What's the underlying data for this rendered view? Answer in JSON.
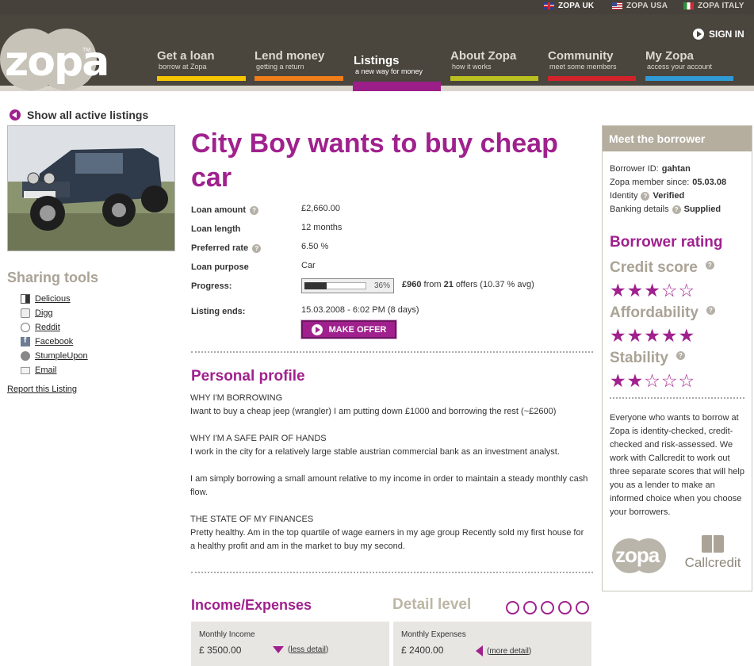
{
  "countries": [
    {
      "label": "ZOPA UK",
      "flag": "uk-flag-icon",
      "active": true
    },
    {
      "label": "ZOPA USA",
      "flag": "us-flag-icon",
      "active": false
    },
    {
      "label": "ZOPA ITALY",
      "flag": "italy-flag-icon",
      "active": false
    }
  ],
  "logo": {
    "text": "zopa",
    "tm": "TM"
  },
  "signin": "SIGN IN",
  "nav": [
    {
      "title": "Get a loan",
      "sub": "borrow at Zopa",
      "color": "#f5c500"
    },
    {
      "title": "Lend money",
      "sub": "getting a return",
      "color": "#ef7d1a"
    },
    {
      "title": "Listings",
      "sub": "a new way for money",
      "color": "#9c1e88"
    },
    {
      "title": "About Zopa",
      "sub": "how it works",
      "color": "#b9c01f"
    },
    {
      "title": "Community",
      "sub": "meet some members",
      "color": "#d2232a"
    },
    {
      "title": "My Zopa",
      "sub": "access your account",
      "color": "#2f9ad6"
    }
  ],
  "back_link": "Show all active listings",
  "sharing": {
    "title": "Sharing tools",
    "items": [
      "Delicious",
      "Digg",
      "Reddit",
      "Facebook",
      "StumpleUpon",
      "Email"
    ],
    "report": "Report this Listing"
  },
  "listing": {
    "title": "City Boy wants to buy cheap car",
    "loan_amount_label": "Loan amount",
    "loan_amount": "£2,660.00",
    "loan_length_label": "Loan length",
    "loan_length": "12 months",
    "preferred_rate_label": "Preferred rate",
    "preferred_rate": "6.50 %",
    "loan_purpose_label": "Loan purpose",
    "loan_purpose": "Car",
    "progress_label": "Progress:",
    "progress_pct_text": "36%",
    "progress_fraction": 0.36,
    "progress_amount": "£960",
    "progress_from": "from",
    "progress_offers": "21",
    "progress_rest": "offers (10.37 % avg)",
    "ends_label": "Listing ends:",
    "ends": "15.03.2008 - 6:02 PM (8 days)",
    "make_offer": "MAKE OFFER"
  },
  "profile": {
    "title": "Personal profile",
    "p1_head": "WHY I'M BORROWING",
    "p1_body": "Iwant to buy a cheap jeep (wrangler) I am putting down £1000 and borrowing the rest (~£2600)",
    "p2_head": "WHY I'M A SAFE PAIR OF HANDS",
    "p2_body": "I work in the city for a relatively large stable austrian commercial bank as an investment analyst.",
    "p3_body": "I am simply borrowing a small amount relative to my income in order to maintain a steady monthly cash flow.",
    "p4_head": "THE STATE OF MY FINANCES",
    "p4_body": "Pretty healthy. Am in the top quartile of wage earners in my age group Recently sold my first house for a healthy profit and am in the market to buy my second."
  },
  "finance": {
    "title": "Income/Expenses",
    "detail_level": "Detail level",
    "income_label": "Monthly Income",
    "currency": "£",
    "income_value": "3500.00",
    "income_toggle": "less detail",
    "expenses_label": "Monthly Expenses",
    "expenses_value": "2400.00",
    "expenses_toggle": "more detail"
  },
  "borrower": {
    "header": "Meet the borrower",
    "id_label": "Borrower ID:",
    "id": "gahtan",
    "since_label": "Zopa member since:",
    "since": "05.03.08",
    "identity_label": "Identity",
    "identity": "Verified",
    "banking_label": "Banking details",
    "banking": "Supplied",
    "rating_title": "Borrower rating",
    "credit_label": "Credit score",
    "credit_stars": 3,
    "afford_label": "Affordability",
    "afford_stars": 5,
    "stability_label": "Stability",
    "stability_stars": 2,
    "blurb": "Everyone who wants to borrow at Zopa is identity-checked, credit-checked and risk-assessed. We work with Callcredit to work out three separate scores that will help you as a lender to make an informed choice when you choose your borrowers.",
    "partner_zopa": "zopa",
    "partner_callcredit": "Callcredit"
  },
  "colors": {
    "accent": "#a0218e",
    "header": "#4a453d",
    "muted": "#aaa396"
  }
}
